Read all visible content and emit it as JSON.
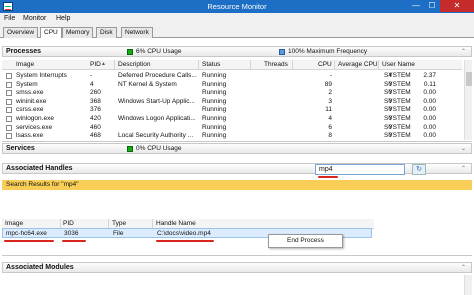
{
  "window": {
    "title": "Resource Monitor",
    "min": "—",
    "max": "☐",
    "close": "✕"
  },
  "menu": [
    "File",
    "Monitor",
    "Help"
  ],
  "tabs": [
    "Overview",
    "CPU",
    "Memory",
    "Disk",
    "Network"
  ],
  "processes": {
    "title": "Processes",
    "usage": "6% CPU Usage",
    "frequency": "100% Maximum Frequency",
    "columns": {
      "image": "Image",
      "pid": "PID",
      "description": "Description",
      "status": "Status",
      "threads": "Threads",
      "cpu": "CPU",
      "avg_cpu": "Average CPU",
      "user": "User Name"
    },
    "rows": [
      {
        "image": "System Interrupts",
        "pid": "-",
        "description": "Deferred Procedure Calls...",
        "status": "Running",
        "threads": "-",
        "cpu": "4",
        "avg_cpu": "2.37",
        "user": "SYSTEM"
      },
      {
        "image": "System",
        "pid": "4",
        "description": "NT Kernel & System",
        "status": "Running",
        "threads": "89",
        "cpu": "0",
        "avg_cpu": "0.11",
        "user": "SYSTEM"
      },
      {
        "image": "smss.exe",
        "pid": "260",
        "description": "",
        "status": "Running",
        "threads": "2",
        "cpu": "0",
        "avg_cpu": "0.00",
        "user": "SYSTEM"
      },
      {
        "image": "wininit.exe",
        "pid": "368",
        "description": "Windows Start-Up Applic...",
        "status": "Running",
        "threads": "3",
        "cpu": "0",
        "avg_cpu": "0.00",
        "user": "SYSTEM"
      },
      {
        "image": "csrss.exe",
        "pid": "376",
        "description": "",
        "status": "Running",
        "threads": "11",
        "cpu": "0",
        "avg_cpu": "0.00",
        "user": "SYSTEM"
      },
      {
        "image": "winlogon.exe",
        "pid": "420",
        "description": "Windows Logon Applicati...",
        "status": "Running",
        "threads": "4",
        "cpu": "0",
        "avg_cpu": "0.00",
        "user": "SYSTEM"
      },
      {
        "image": "services.exe",
        "pid": "460",
        "description": "",
        "status": "Running",
        "threads": "6",
        "cpu": "0",
        "avg_cpu": "0.00",
        "user": "SYSTEM"
      },
      {
        "image": "lsass.exe",
        "pid": "468",
        "description": "Local Security Authority ...",
        "status": "Running",
        "threads": "8",
        "cpu": "0",
        "avg_cpu": "0.00",
        "user": "SYSTEM"
      }
    ]
  },
  "services": {
    "title": "Services",
    "usage": "0% CPU Usage"
  },
  "handles": {
    "title": "Associated Handles",
    "search_value": "mp4",
    "search_go": "↻",
    "results_label": "Search Results for \"mp4\"",
    "columns": {
      "image": "Image",
      "pid": "PID",
      "type": "Type",
      "handle": "Handle Name"
    },
    "rows": [
      {
        "image": "mpc-hc64.exe",
        "pid": "3036",
        "type": "File",
        "handle": "C:\\docs\\video.mp4"
      }
    ]
  },
  "context_menu": {
    "end_process": "End Process"
  },
  "modules": {
    "title": "Associated Modules"
  },
  "colors": {
    "titlebar": "#1c6fc4",
    "close": "#c62b2b",
    "highlight": "#f8ce56",
    "annotation": "#d9251c"
  }
}
